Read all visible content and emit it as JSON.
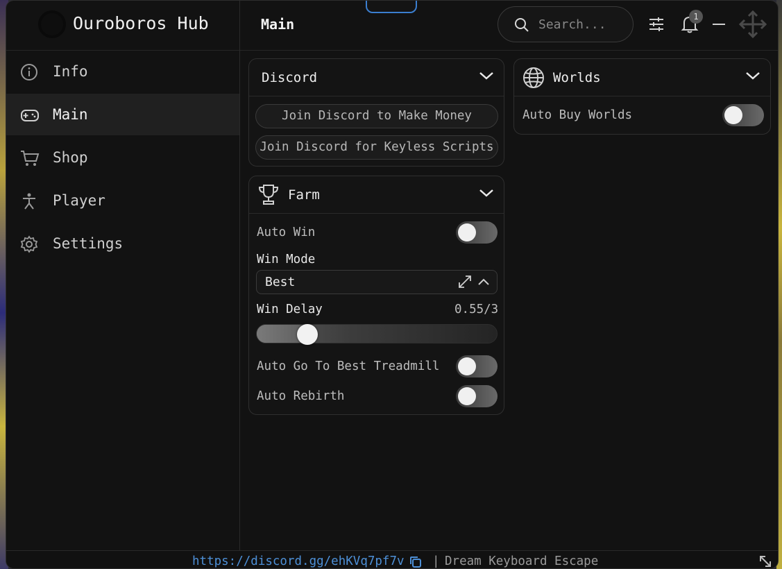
{
  "app": {
    "title": "Ouroboros Hub",
    "section": "Main"
  },
  "search": {
    "placeholder": "Search..."
  },
  "notifications": {
    "count": "1"
  },
  "sidebar": {
    "items": [
      {
        "label": "Info",
        "icon": "info-icon"
      },
      {
        "label": "Main",
        "icon": "gamepad-icon",
        "active": true
      },
      {
        "label": "Shop",
        "icon": "cart-icon"
      },
      {
        "label": "Player",
        "icon": "person-icon"
      },
      {
        "label": "Settings",
        "icon": "gear-icon"
      }
    ]
  },
  "discord_panel": {
    "title": "Discord",
    "buttons": [
      "Join Discord to Make Money",
      "Join Discord for Keyless Scripts"
    ]
  },
  "farm_panel": {
    "title": "Farm",
    "auto_win": {
      "label": "Auto Win",
      "on": false
    },
    "win_mode": {
      "label": "Win Mode",
      "value": "Best"
    },
    "win_delay": {
      "label": "Win Delay",
      "display": "0.55/3",
      "value": 0.55,
      "max": 3
    },
    "auto_treadmill": {
      "label": "Auto Go To Best Treadmill",
      "on": false
    },
    "auto_rebirth": {
      "label": "Auto Rebirth",
      "on": false
    }
  },
  "worlds_panel": {
    "title": "Worlds",
    "auto_buy": {
      "label": "Auto Buy Worlds",
      "on": false
    }
  },
  "footer": {
    "link": "https://discord.gg/ehKVq7pf7v",
    "separator": "|",
    "game": "Dream Keyboard Escape"
  },
  "colors": {
    "accent_link": "#4d8fd6",
    "tab_outline": "#3b7ecf",
    "background": "#121212"
  }
}
